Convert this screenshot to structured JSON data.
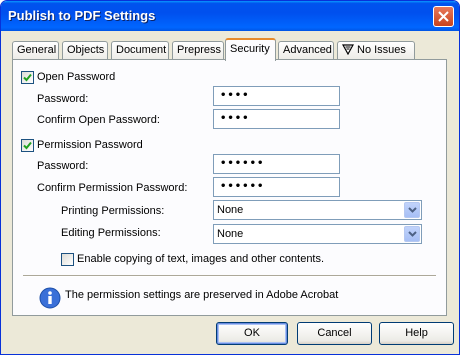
{
  "window": {
    "title": "Publish to PDF Settings"
  },
  "tabs": [
    {
      "label": "General"
    },
    {
      "label": "Objects"
    },
    {
      "label": "Document"
    },
    {
      "label": "Prepress"
    },
    {
      "label": "Security"
    },
    {
      "label": "Advanced"
    },
    {
      "label": "No Issues",
      "icon": "no-issues-icon"
    }
  ],
  "active_tab": "Security",
  "open_password": {
    "checkbox_label": "Open Password",
    "checked": true,
    "password_label": "Password:",
    "password_value": "••••",
    "confirm_label": "Confirm Open Password:",
    "confirm_value": "••••"
  },
  "permission_password": {
    "checkbox_label": "Permission Password",
    "checked": true,
    "password_label": "Password:",
    "password_value": "••••••",
    "confirm_label": "Confirm Permission Password:",
    "confirm_value": "••••••",
    "printing_label": "Printing Permissions:",
    "printing_value": "None",
    "editing_label": "Editing Permissions:",
    "editing_value": "None",
    "copying_label": "Enable copying of text, images and other contents.",
    "copying_checked": false
  },
  "info": {
    "icon": "info-icon",
    "text": "The permission settings are preserved in Adobe Acrobat"
  },
  "buttons": {
    "ok": "OK",
    "cancel": "Cancel",
    "help": "Help"
  },
  "colors": {
    "title_bar": "#0053ee",
    "dialog_bg": "#ece9d8",
    "active_tab_accent": "#e68b2c"
  }
}
